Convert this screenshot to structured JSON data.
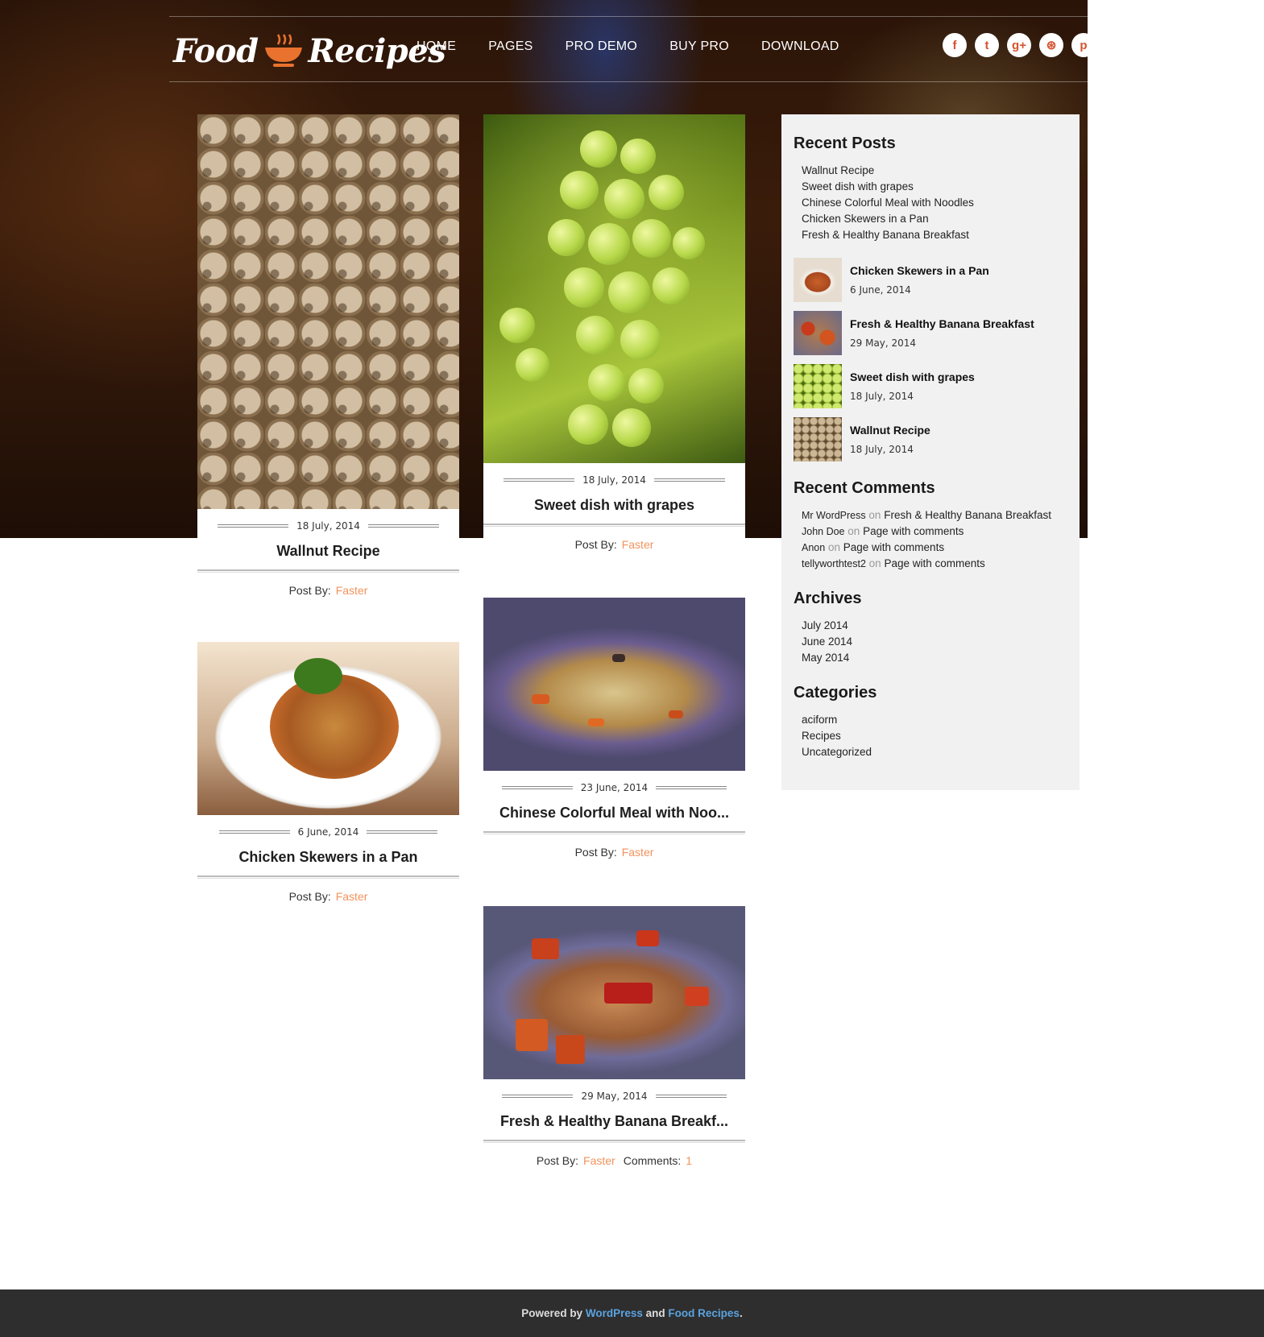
{
  "brand": {
    "logo_left": "Food",
    "logo_right": "Recipes",
    "accent": "#e8722e"
  },
  "nav": [
    "HOME",
    "PAGES",
    "PRO DEMO",
    "BUY PRO",
    "DOWNLOAD"
  ],
  "social": [
    {
      "icon": "facebook-icon",
      "glyph": "f"
    },
    {
      "icon": "twitter-icon",
      "glyph": "t"
    },
    {
      "icon": "google-plus-icon",
      "glyph": "g+"
    },
    {
      "icon": "dribbble-icon",
      "glyph": "⊛"
    },
    {
      "icon": "pinterest-icon",
      "glyph": "p"
    }
  ],
  "posts": [
    {
      "date": "18 July, 2014",
      "title": "Wallnut Recipe",
      "post_by_label": "Post By:",
      "author": "Faster"
    },
    {
      "date": "18 July, 2014",
      "title": "Sweet dish with grapes",
      "post_by_label": "Post By:",
      "author": "Faster"
    },
    {
      "date": "6 June, 2014",
      "title": "Chicken Skewers in a Pan",
      "post_by_label": "Post By:",
      "author": "Faster"
    },
    {
      "date": "23 June, 2014",
      "title": "Chinese Colorful Meal with Noo...",
      "post_by_label": "Post By:",
      "author": "Faster"
    },
    {
      "date": "29 May, 2014",
      "title": "Fresh & Healthy Banana Breakf...",
      "post_by_label": "Post By:",
      "author": "Faster",
      "comments_label": "Comments:",
      "comments": "1"
    }
  ],
  "sidebar": {
    "recent_posts_title": "Recent Posts",
    "recent_posts": [
      "Wallnut Recipe",
      "Sweet dish with grapes",
      "Chinese Colorful Meal with Noodles",
      "Chicken Skewers in a Pan",
      "Fresh & Healthy Banana Breakfast"
    ],
    "thumb_posts": [
      {
        "title": "Chicken Skewers in a Pan",
        "date": "6 June, 2014"
      },
      {
        "title": "Fresh & Healthy Banana Breakfast",
        "date": "29 May, 2014"
      },
      {
        "title": "Sweet dish with grapes",
        "date": "18 July, 2014"
      },
      {
        "title": "Wallnut Recipe",
        "date": "18 July, 2014"
      }
    ],
    "recent_comments_title": "Recent Comments",
    "comments": [
      {
        "author": "Mr WordPress",
        "on": "on",
        "post": "Fresh & Healthy Banana Breakfast"
      },
      {
        "author": "John Doe",
        "on": "on",
        "post": "Page with comments"
      },
      {
        "author": "Anon",
        "on": "on",
        "post": "Page with comments"
      },
      {
        "author": "tellyworthtest2",
        "on": "on",
        "post": "Page with comments"
      }
    ],
    "archives_title": "Archives",
    "archives": [
      "July 2014",
      "June 2014",
      "May 2014"
    ],
    "categories_title": "Categories",
    "categories": [
      "aciform",
      "Recipes",
      "Uncategorized"
    ]
  },
  "footer": {
    "prefix": "Powered by",
    "wp": "WordPress",
    "and": "and",
    "theme": "Food Recipes",
    "suffix": "."
  }
}
